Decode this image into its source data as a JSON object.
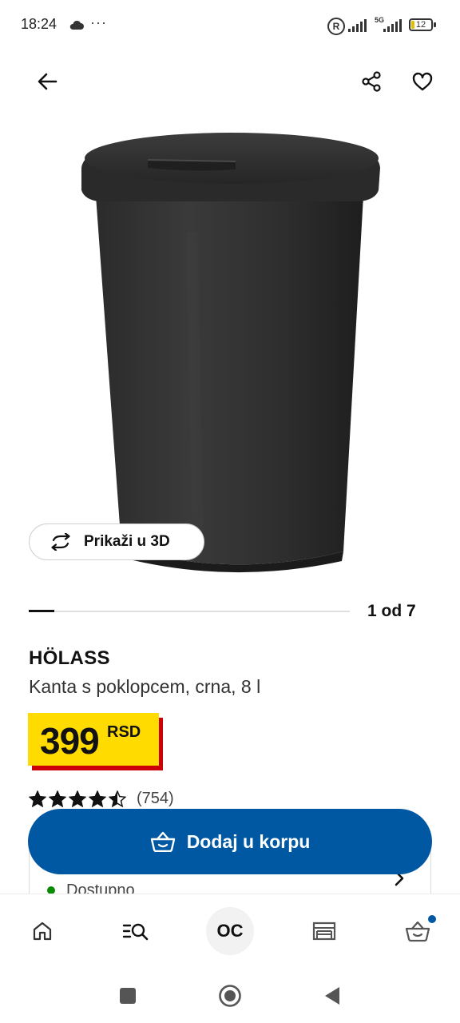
{
  "status_bar": {
    "time": "18:24",
    "more": "···",
    "network": "5G",
    "battery": "12",
    "cloud_icon": "cloud-icon",
    "registered_icon": "R"
  },
  "app_bar": {
    "back_icon": "arrow-left-icon",
    "share_icon": "share-icon",
    "favorite_icon": "heart-icon"
  },
  "gallery": {
    "view_3d_label": "Prikaži u 3D",
    "counter": "1 od 7",
    "current": 1,
    "total": 7
  },
  "product": {
    "name": "HÖLASS",
    "description": "Kanta s poklopcem, crna, 8 l",
    "price": "399",
    "currency": "RSD",
    "rating": 4.5,
    "rating_count": "(754)"
  },
  "availability": {
    "status": "Dostupno",
    "status_color": "#0a8a00"
  },
  "cta": {
    "add_to_cart": "Dodaj u korpu",
    "color": "#0058a3"
  },
  "bottom_nav": {
    "items": [
      {
        "icon": "home-icon"
      },
      {
        "icon": "search-menu-icon"
      },
      {
        "icon": "profile-icon",
        "label": "OC"
      },
      {
        "icon": "store-icon"
      },
      {
        "icon": "cart-icon"
      }
    ]
  },
  "colors": {
    "price_tag": "#ffdb00",
    "price_shadow": "#cc0008",
    "primary": "#0058a3"
  }
}
